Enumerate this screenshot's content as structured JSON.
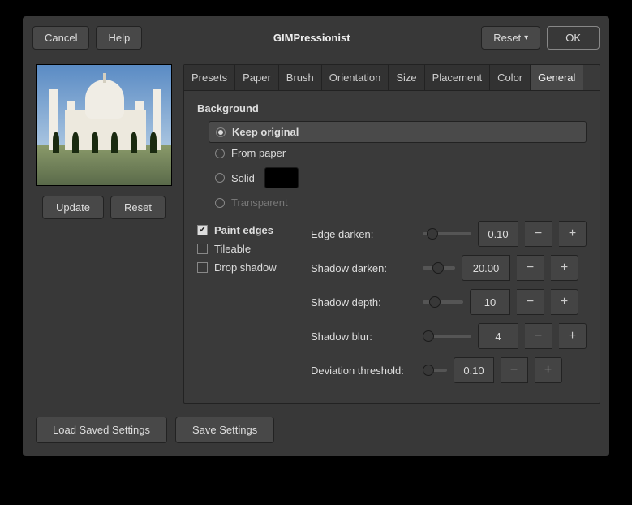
{
  "titlebar": {
    "cancel": "Cancel",
    "help": "Help",
    "title": "GIMPressionist",
    "reset": "Reset",
    "ok": "OK"
  },
  "preview": {
    "update": "Update",
    "reset": "Reset"
  },
  "tabs": [
    "Presets",
    "Paper",
    "Brush",
    "Orientation",
    "Size",
    "Placement",
    "Color",
    "General"
  ],
  "activeTab": 7,
  "general": {
    "section": "Background",
    "radios": {
      "keep": "Keep original",
      "paper": "From paper",
      "solid": "Solid",
      "transparent": "Transparent"
    },
    "checks": {
      "paintEdges": "Paint edges",
      "tileable": "Tileable",
      "dropShadow": "Drop shadow"
    },
    "sliders": {
      "edgeDarken": {
        "label": "Edge darken:",
        "value": "0.10",
        "pos": 5
      },
      "shadowDarken": {
        "label": "Shadow darken:",
        "value": "20.00",
        "pos": 12
      },
      "shadowDepth": {
        "label": "Shadow depth:",
        "value": "10",
        "pos": 8
      },
      "shadowBlur": {
        "label": "Shadow blur:",
        "value": "4",
        "pos": 0
      },
      "deviation": {
        "label": "Deviation threshold:",
        "value": "0.10",
        "pos": 0
      }
    }
  },
  "footer": {
    "load": "Load Saved Settings",
    "save": "Save Settings"
  }
}
